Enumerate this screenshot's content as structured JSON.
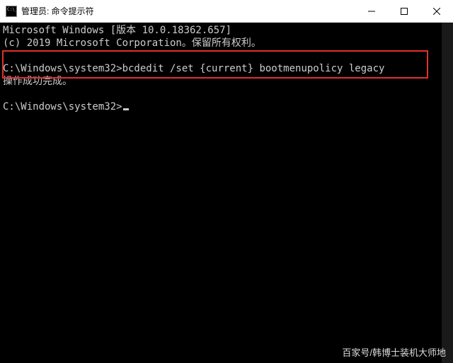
{
  "window": {
    "title": "管理员: 命令提示符"
  },
  "console": {
    "header_line1": "Microsoft Windows [版本 10.0.18362.657]",
    "header_line2": "(c) 2019 Microsoft Corporation。保留所有权利。",
    "cmd1_prompt": "C:\\Windows\\system32>",
    "cmd1_input": "bcdedit /set {current} bootmenupolicy legacy",
    "cmd1_output": "操作成功完成。",
    "cmd2_prompt": "C:\\Windows\\system32>"
  },
  "watermark": "百家号/韩博士装机大师地"
}
